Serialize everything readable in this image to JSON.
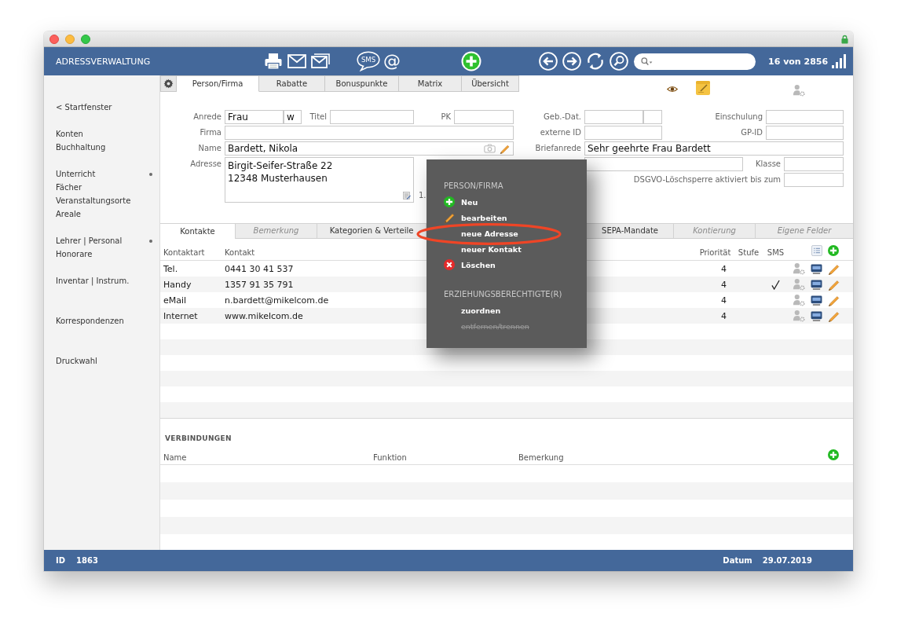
{
  "header": {
    "title": "ADRESSVERWALTUNG",
    "sms_label": "SMS",
    "at_label": "@",
    "record_position": "16 von 2856"
  },
  "sidebar": {
    "groups": [
      {
        "items": [
          {
            "label": "< Startfenster",
            "bullet": false
          }
        ]
      },
      {
        "items": [
          {
            "label": "Konten",
            "bullet": false
          },
          {
            "label": "Buchhaltung",
            "bullet": false
          }
        ]
      },
      {
        "items": [
          {
            "label": "Unterricht",
            "bullet": true
          },
          {
            "label": "Fächer",
            "bullet": false
          },
          {
            "label": "Veranstaltungsorte",
            "bullet": false
          },
          {
            "label": "Areale",
            "bullet": false
          }
        ]
      },
      {
        "items": [
          {
            "label": "Lehrer | Personal",
            "bullet": true
          },
          {
            "label": "Honorare",
            "bullet": false
          }
        ]
      },
      {
        "items": [
          {
            "label": "Inventar | Instrum.",
            "bullet": false
          }
        ]
      },
      {
        "items": [
          {
            "label": "Korrespondenzen",
            "bullet": false
          }
        ]
      },
      {
        "items": [
          {
            "label": "Druckwahl",
            "bullet": false
          }
        ]
      }
    ]
  },
  "record_tabs": [
    {
      "label": "Person/Firma",
      "selected": true
    },
    {
      "label": "Rabatte",
      "selected": false
    },
    {
      "label": "Bonuspunkte",
      "selected": false
    },
    {
      "label": "Matrix",
      "selected": false
    },
    {
      "label": "Übersicht",
      "selected": false
    }
  ],
  "form": {
    "anrede": {
      "label": "Anrede",
      "value": "Frau",
      "suffix": "w"
    },
    "titel": {
      "label": "Titel"
    },
    "pk": {
      "label": "PK"
    },
    "geb_dat": {
      "label": "Geb.-Dat."
    },
    "einschulung": {
      "label": "Einschulung"
    },
    "firma": {
      "label": "Firma"
    },
    "externe_id": {
      "label": "externe ID"
    },
    "gp_id": {
      "label": "GP-ID"
    },
    "name": {
      "label": "Name",
      "value": "Bardett, Nikola"
    },
    "briefanrede": {
      "label": "Briefanrede",
      "value": "Sehr geehrte Frau Bardett"
    },
    "adresse": {
      "label": "Adresse",
      "lines": [
        "Birgit-Seifer-Straße 22",
        "12348 Musterhausen"
      ]
    },
    "klasse": {
      "label": "Klasse"
    },
    "dsgvo_sperre": {
      "label": "DSGVO-Löschsperre aktiviert bis zum"
    },
    "kontakt_label": "1."
  },
  "detail_tabs": [
    {
      "label": "Kontakte",
      "selected": true,
      "empty": false
    },
    {
      "label": "Bemerkung",
      "selected": false,
      "empty": true
    },
    {
      "label": "Kategorien & Verteile",
      "selected": false,
      "empty": false
    },
    {
      "label": "SEPA-Mandate",
      "selected": false,
      "empty": false
    },
    {
      "label": "Kontierung",
      "selected": false,
      "empty": true
    },
    {
      "label": "Eigene Felder",
      "selected": false,
      "empty": true
    }
  ],
  "contacts": {
    "columns": [
      "Kontaktart",
      "Kontakt",
      "Priorität",
      "Stufe",
      "SMS"
    ],
    "rows": [
      {
        "type": "Tel.",
        "contact": "0441 30 41 537",
        "priority": "4",
        "sms": false
      },
      {
        "type": "Handy",
        "contact": "1357 91 35 791",
        "priority": "4",
        "sms": true
      },
      {
        "type": "eMail",
        "contact": "n.bardett@mikelcom.de",
        "priority": "4",
        "sms": false
      },
      {
        "type": "Internet",
        "contact": "www.mikelcom.de",
        "priority": "4",
        "sms": false
      }
    ]
  },
  "connections": {
    "title": "VERBINDUNGEN",
    "columns": [
      "Name",
      "Funktion",
      "Bemerkung"
    ]
  },
  "status_bar": {
    "id_label": "ID",
    "id": "1863",
    "date_label": "Datum",
    "date": "29.07.2019"
  },
  "context_menu": {
    "sections": [
      {
        "heading": "PERSON/FIRMA",
        "items": [
          {
            "label": "Neu",
            "kind": "add",
            "disabled": false,
            "circled": false
          },
          {
            "label": "bearbeiten",
            "kind": "edit",
            "disabled": false,
            "circled": false
          },
          {
            "label": "neue Adresse",
            "kind": "plain",
            "disabled": false,
            "circled": true
          },
          {
            "label": "neuer Kontakt",
            "kind": "plain",
            "disabled": false,
            "circled": false
          },
          {
            "label": "Löschen",
            "kind": "delete",
            "disabled": false,
            "circled": false
          }
        ]
      },
      {
        "heading": "ERZIEHUNGSBERECHTIGTE(R)",
        "items": [
          {
            "label": "zuordnen",
            "kind": "plain",
            "disabled": false,
            "circled": false
          },
          {
            "label": "entfernen/trennen",
            "kind": "plain",
            "disabled": true,
            "circled": false
          }
        ]
      }
    ]
  }
}
